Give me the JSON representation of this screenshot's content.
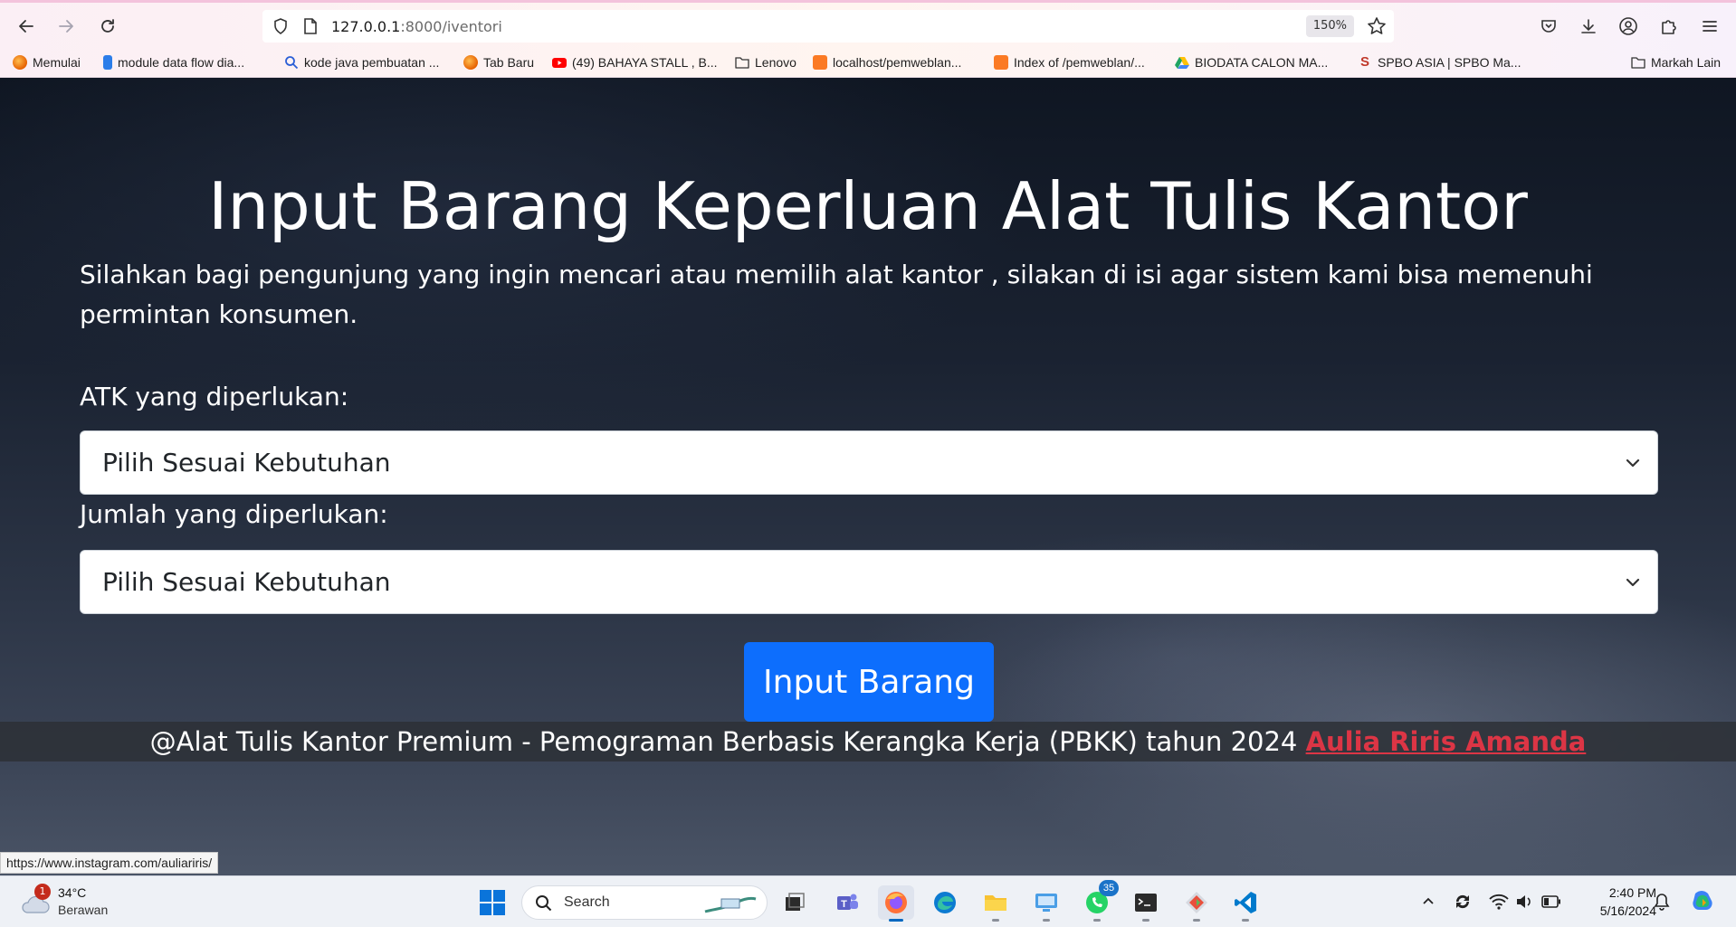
{
  "browser": {
    "url_host": "127.0.0.1",
    "url_path": ":8000/iventori",
    "zoom": "150%"
  },
  "bookmarks": {
    "items": [
      {
        "label": "Memulai",
        "icon": "firefox-icon"
      },
      {
        "label": "module data flow dia...",
        "icon": "bing-icon"
      },
      {
        "label": "kode java pembuatan ...",
        "icon": "search-icon"
      },
      {
        "label": "Tab Baru",
        "icon": "firefox-icon"
      },
      {
        "label": "(49) BAHAYA STALL , B...",
        "icon": "youtube-icon"
      },
      {
        "label": "Lenovo",
        "icon": "folder-icon"
      },
      {
        "label": "localhost/pemweblan...",
        "icon": "xampp-icon"
      },
      {
        "label": "Index of /pemweblan/...",
        "icon": "xampp-icon"
      },
      {
        "label": "BIODATA CALON MA...",
        "icon": "google-drive-icon"
      },
      {
        "label": "SPBO ASIA | SPBO Ma...",
        "icon": "spbo-icon"
      }
    ],
    "other": "Markah Lain"
  },
  "page": {
    "title": "Input Barang Keperluan Alat Tulis Kantor",
    "description": "Silahkan bagi pengunjung yang ingin mencari atau memilih alat kantor , silakan di isi agar sistem kami bisa memenuhi permintan konsumen.",
    "form": {
      "atk_label": "ATK yang diperlukan:",
      "atk_selected": "Pilih Sesuai Kebutuhan",
      "jumlah_label": "Jumlah yang diperlukan:",
      "jumlah_selected": "Pilih Sesuai Kebutuhan",
      "submit_label": "Input Barang"
    },
    "footer": {
      "text": "@Alat Tulis Kantor Premium - Pemograman Berbasis Kerangka Kerja (PBKK) tahun 2024",
      "author": "Aulia Riris Amanda"
    }
  },
  "status_bar": {
    "link": "https://www.instagram.com/auliariris/"
  },
  "taskbar": {
    "weather_temp": "34°C",
    "weather_cond": "Berawan",
    "weather_badge": "1",
    "search_placeholder": "Search",
    "whatsapp_badge": "35",
    "time": "2:40 PM",
    "date": "5/16/2024"
  },
  "colors": {
    "primary_button": "#0d6efd",
    "author_link": "#dc3545"
  }
}
